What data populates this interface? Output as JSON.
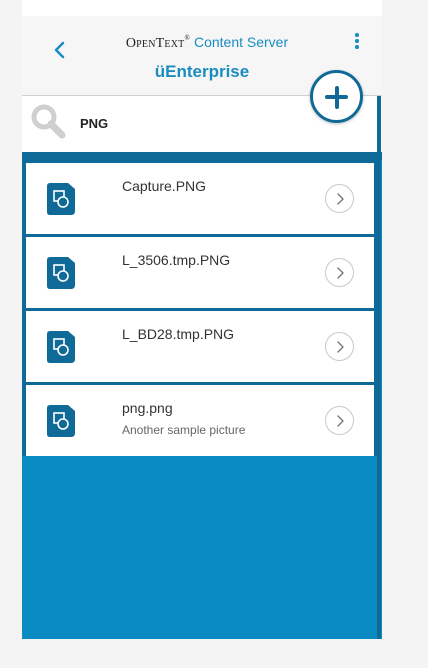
{
  "header": {
    "brand_name": "OpenText",
    "brand_tm": "®",
    "brand_product": "Content Server",
    "subtitle": "üEnterprise"
  },
  "search": {
    "value": "PNG",
    "placeholder": "Search"
  },
  "results": [
    {
      "name": "Capture.PNG",
      "description": ""
    },
    {
      "name": "L_3506.tmp.PNG",
      "description": ""
    },
    {
      "name": "L_BD28.tmp.PNG",
      "description": ""
    },
    {
      "name": "png.png",
      "description": "Another sample picture"
    }
  ],
  "colors": {
    "accent": "#1a8dc0",
    "dark": "#0f6a97",
    "background": "#0a8cc2"
  },
  "icons": {
    "back": "chevron-left-icon",
    "more": "more-vertical-icon",
    "add": "plus-icon",
    "search": "search-icon",
    "file": "image-file-icon",
    "open": "chevron-right-icon"
  }
}
